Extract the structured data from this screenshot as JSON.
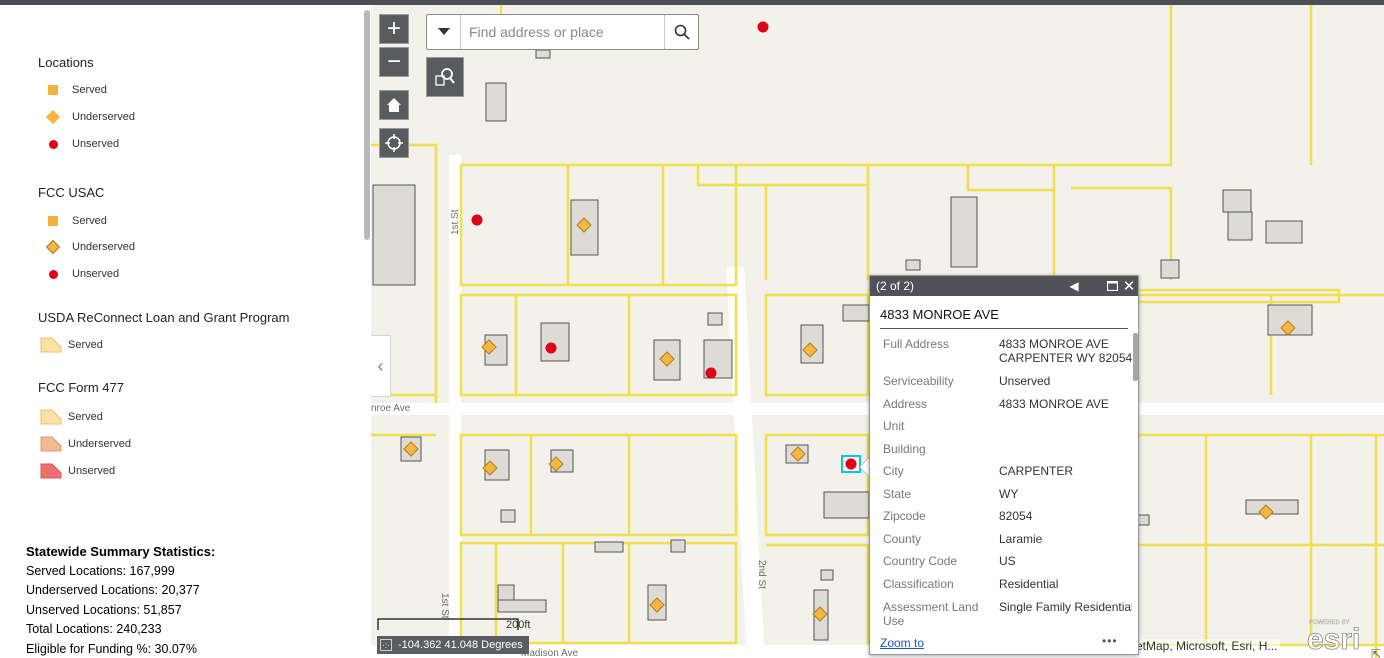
{
  "legend": {
    "groups": [
      {
        "title": "Locations",
        "items": [
          {
            "symbol": "square-icon",
            "label": "Served",
            "color": "#f2b33d"
          },
          {
            "symbol": "diamond-icon",
            "label": "Underserved",
            "color": "#f7b640"
          },
          {
            "symbol": "dot-icon",
            "label": "Unserved",
            "color": "#e0001a"
          }
        ]
      },
      {
        "title": "FCC USAC",
        "items": [
          {
            "symbol": "square-icon",
            "label": "Served",
            "color": "#f2b33d"
          },
          {
            "symbol": "diamond-icon",
            "label": "Underserved",
            "color": "#f7b640"
          },
          {
            "symbol": "dot-icon",
            "label": "Unserved",
            "color": "#e0001a"
          }
        ]
      },
      {
        "title": "USDA ReConnect Loan and Grant Program",
        "items": [
          {
            "symbol": "polygon-icon",
            "label": "Served",
            "color": "#fbe3a6"
          }
        ]
      },
      {
        "title": "FCC Form 477",
        "items": [
          {
            "symbol": "polygon-icon",
            "label": "Served",
            "color": "#fbe3a6"
          },
          {
            "symbol": "polygon-icon",
            "label": "Underserved",
            "color": "#f2b892"
          },
          {
            "symbol": "polygon-icon",
            "label": "Unserved",
            "color": "#ee6f6f"
          }
        ]
      }
    ]
  },
  "stats": {
    "title": "Statewide Summary Statistics:",
    "lines": [
      "Served Locations: 167,999",
      "Underserved Locations: 20,377",
      "Unserved Locations: 51,857",
      "Total Locations: 240,233",
      "Eligible for Funding %: 30.07%"
    ]
  },
  "map": {
    "controls": {
      "zoom_in": "+",
      "zoom_out": "−"
    },
    "search": {
      "placeholder": "Find address or place"
    },
    "streets": {
      "monroe": "nroe Ave",
      "first_upper": "1st St",
      "first_lower": "1st St",
      "second": "2nd St",
      "madison": "Madison Ave"
    },
    "scale_label": "200ft",
    "coords": "-104.362 41.048 Degrees",
    "attribution": "etMap, Microsoft, Esri, H...",
    "esri_logo": {
      "powered": "POWERED BY",
      "name": "esri"
    }
  },
  "popup": {
    "counter": "(2 of 2)",
    "title": "4833 MONROE AVE",
    "fields": [
      {
        "key": "Full Address",
        "value": "4833 MONROE AVE CARPENTER WY 82054"
      },
      {
        "key": "Serviceability",
        "value": "Unserved"
      },
      {
        "key": "Address",
        "value": "4833 MONROE AVE"
      },
      {
        "key": "Unit",
        "value": ""
      },
      {
        "key": "Building",
        "value": ""
      },
      {
        "key": "City",
        "value": "CARPENTER"
      },
      {
        "key": "State",
        "value": "WY"
      },
      {
        "key": "Zipcode",
        "value": "82054"
      },
      {
        "key": "County",
        "value": "Laramie"
      },
      {
        "key": "Country Code",
        "value": "US"
      },
      {
        "key": "Classification",
        "value": "Residential"
      },
      {
        "key": "Assessment Land Use",
        "value": "Single Family Residential"
      }
    ],
    "zoom_to": "Zoom to",
    "more": "•••"
  }
}
